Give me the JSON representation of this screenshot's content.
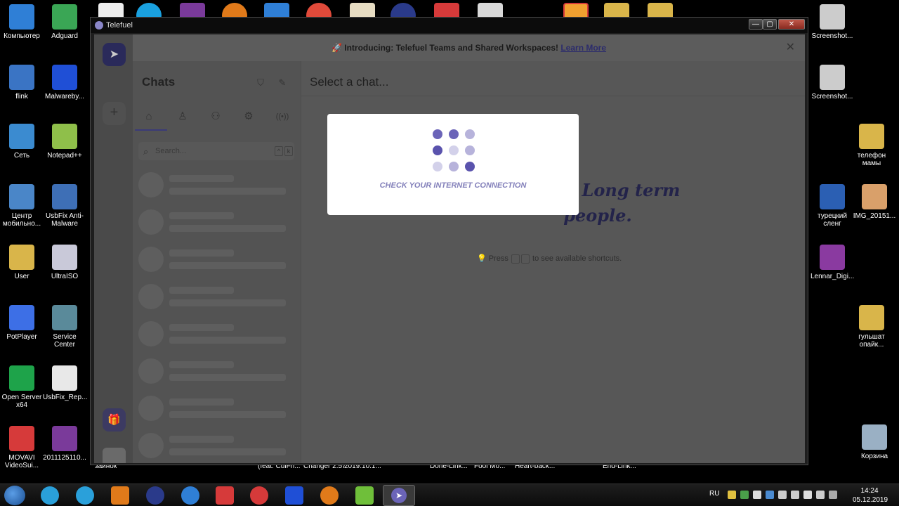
{
  "desktop": {
    "left_icons": [
      {
        "label": "Компьютер",
        "color": "#2f7fd6"
      },
      {
        "label": "Adguard",
        "color": "#3aa655"
      },
      {
        "label": "flink",
        "color": "#3a74c4"
      },
      {
        "label": "Malwareby...",
        "color": "#1f4fd6"
      },
      {
        "label": "Сеть",
        "color": "#3b8bd0"
      },
      {
        "label": "Notepad++",
        "color": "#8fbf4a"
      },
      {
        "label": "Центр мобильно...",
        "color": "#4a86c8"
      },
      {
        "label": "UsbFix Anti-Malware",
        "color": "#3e6fb6"
      },
      {
        "label": "User",
        "color": "#d9b54a"
      },
      {
        "label": "UltraISO",
        "color": "#c9c9d9"
      },
      {
        "label": "PotPlayer",
        "color": "#3d6fe6"
      },
      {
        "label": "Service Center",
        "color": "#5a8a9a"
      },
      {
        "label": "Open Server x64",
        "color": "#1ea34a"
      },
      {
        "label": "UsbFix_Rep...",
        "color": "#e8e8e8"
      },
      {
        "label": "MOVAVI VideoSui...",
        "color": "#d63a3a"
      },
      {
        "label": "2011125110...",
        "color": "#7a3a9a"
      }
    ],
    "right_icons": [
      {
        "label": "Screenshot...",
        "color": "#cccccc"
      },
      {
        "label": "Screenshot...",
        "color": "#cccccc"
      },
      {
        "label": "телефон мамы",
        "color": "#d9b54a"
      },
      {
        "label": "турецкий сленг",
        "color": "#2b5fb3"
      },
      {
        "label": "IMG_20151...",
        "color": "#d9a06a"
      },
      {
        "label": "Lennar_Digi...",
        "color": "#8a3aa0"
      },
      {
        "label": "гульшат опайк...",
        "color": "#d9b54a"
      },
      {
        "label": "Корзина",
        "color": "#9ab0c4"
      }
    ],
    "bottom_labels": [
      "зайнок",
      "(feat. CulFri...",
      "Changer 2.57",
      "2019.10.1...",
      "Done-Link...",
      "Fool Mo...",
      "Heart-back...",
      "End-Link..."
    ]
  },
  "window": {
    "title": "Telefuel",
    "min": "—",
    "max": "▢",
    "close": "✕"
  },
  "banner": {
    "icon": "🚀",
    "text": "Introducing: Telefuel Teams and Shared Workspaces!",
    "link": "Learn More",
    "close": "✕"
  },
  "rail": {
    "add": "+",
    "gift": "🎁"
  },
  "chats": {
    "title": "Chats",
    "filter_icon": "⛉",
    "compose_icon": "✎",
    "tabs": [
      "⌂",
      "♙",
      "⚇",
      "⚙",
      "((•))"
    ],
    "search_placeholder": "Search...",
    "search_key1": "^",
    "search_key2": "k"
  },
  "main": {
    "header": "Select a chat...",
    "tagline": "…mes. Long term people.",
    "hint": "Press",
    "hint_tail": "to see available shortcuts."
  },
  "modal": {
    "message": "CHECK YOUR INTERNET CONNECTION",
    "dot_colors": [
      "#6b64b8",
      "#6b64b8",
      "#b7b3db",
      "#5a53ad",
      "#d3d1ea",
      "#b7b3db",
      "#d3d1ea",
      "#b7b3db",
      "#5a53ad"
    ]
  },
  "taskbar": {
    "lang": "RU",
    "time": "14:24",
    "date": "05.12.2019"
  }
}
